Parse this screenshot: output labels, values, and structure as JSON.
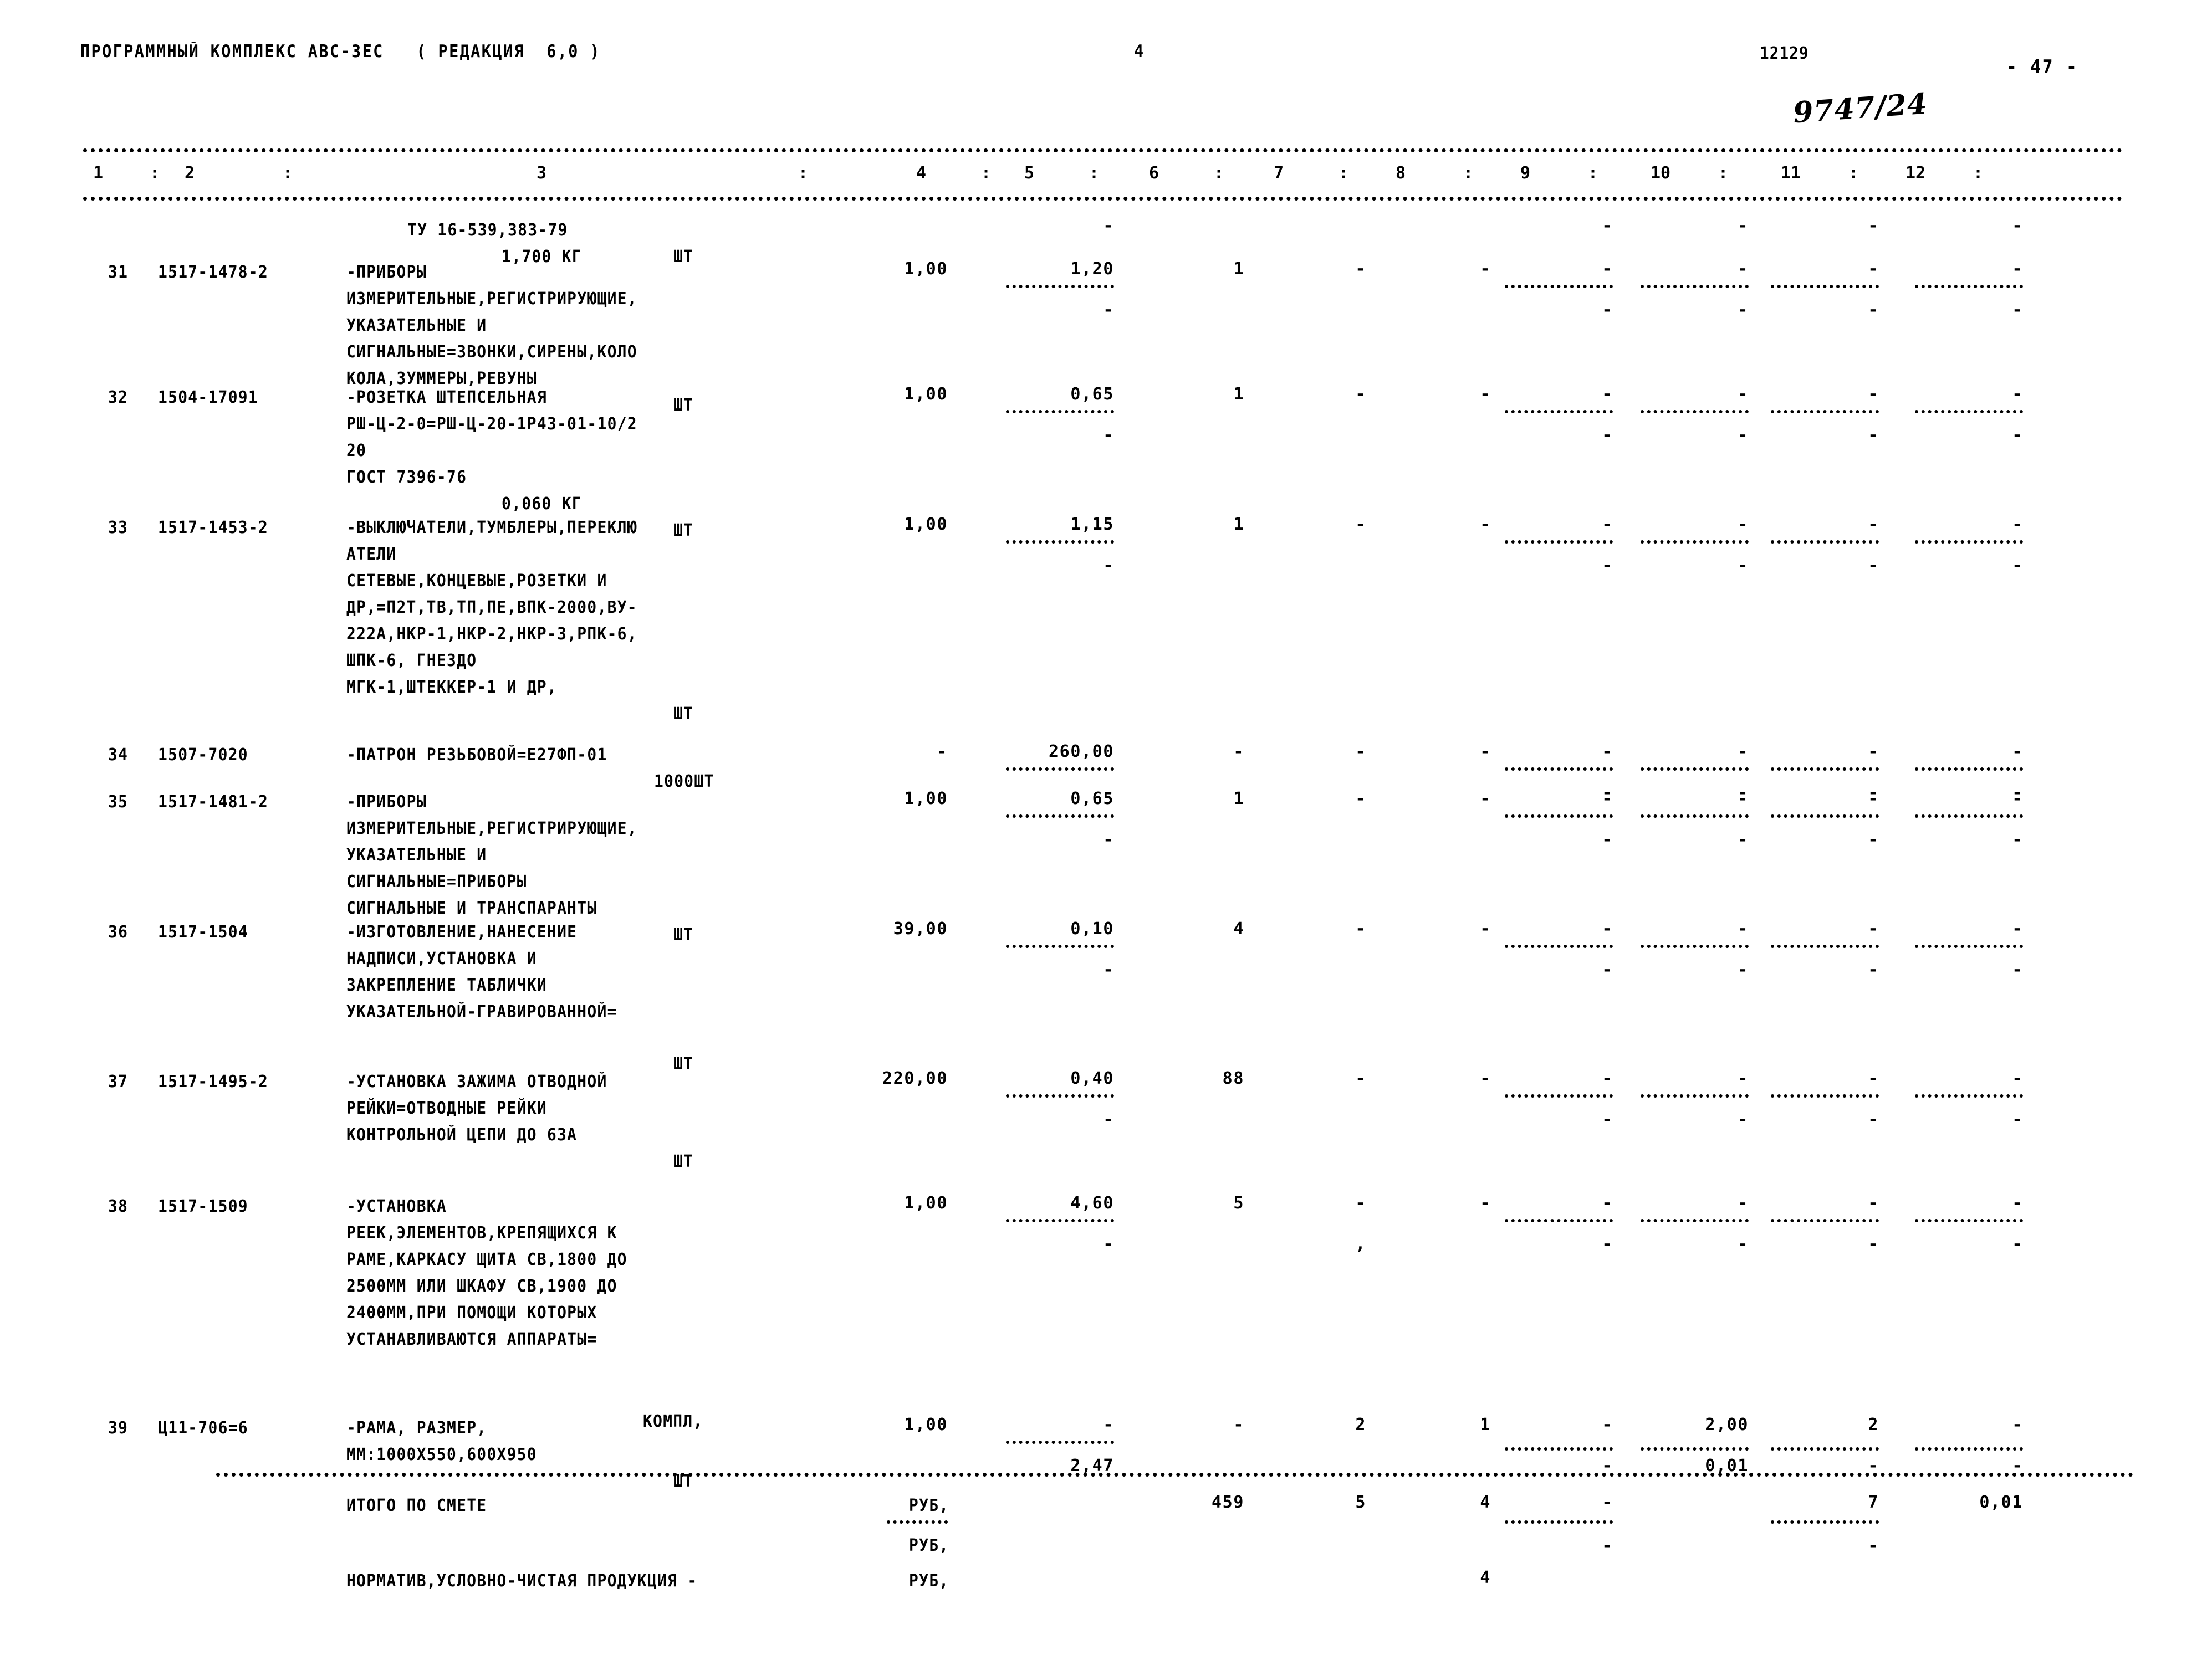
{
  "header": {
    "program_title": "ПРОГРАММНЫЙ КОМПЛЕКС АВС-ЗЕС   ( РЕДАКЦИЯ  6,0 )",
    "page_no": "4",
    "doc_code": "12129",
    "sheet_no": "- 47 -",
    "handwritten_note": "9747/24"
  },
  "column_headers": [
    "1",
    "2",
    "3",
    "4",
    "5",
    "6",
    "7",
    "8",
    "9",
    "10",
    "11",
    "12"
  ],
  "column_separator": ":",
  "rows": [
    {
      "no": "",
      "code": "",
      "desc_lines": [
        "ТУ 16-539,383-79",
        "1,700 КГ"
      ],
      "unit": "ШТ",
      "c4": "",
      "c5": "-",
      "c6": "",
      "c7": "",
      "c8": "",
      "c9": "-",
      "c10": "-",
      "c11": "-",
      "c12": "-"
    },
    {
      "no": "31",
      "code": "1517-1478-2",
      "desc_lines": [
        "-ПРИБОРЫ",
        "ИЗМЕРИТЕЛЬНЫЕ,РЕГИСТРИРУЮЩИЕ,",
        "УКАЗАТЕЛЬНЫЕ И",
        "СИГНАЛЬНЫЕ=ЗВОНКИ,СИРЕНЫ,КОЛО",
        "КОЛА,ЗУММЕРЫ,РЕВУНЫ"
      ],
      "unit": "ШТ",
      "c4": "1,00",
      "c5": "1,20",
      "c6": "1",
      "c7": "-",
      "c8": "-",
      "c9": "-",
      "c10": "-",
      "c11": "-",
      "c12": "-",
      "sub5": "-",
      "sub9": "-",
      "sub10": "-",
      "sub11": "-",
      "sub12": "-"
    },
    {
      "no": "32",
      "code": "1504-17091",
      "desc_lines": [
        "-РОЗЕТКА ШТЕПСЕЛЬНАЯ",
        "РШ-Ц-2-0=РШ-Ц-20-1Р43-01-10/2",
        "20",
        "ГОСТ 7396-76",
        "0,060 КГ"
      ],
      "unit": "ШТ",
      "c4": "1,00",
      "c5": "0,65",
      "c6": "1",
      "c7": "-",
      "c8": "-",
      "c9": "-",
      "c10": "-",
      "c11": "-",
      "c12": "-",
      "sub5": "-",
      "sub9": "-",
      "sub10": "-",
      "sub11": "-",
      "sub12": "-"
    },
    {
      "no": "33",
      "code": "1517-1453-2",
      "desc_lines": [
        "-ВЫКЛЮЧАТЕЛИ,ТУМБЛЕРЫ,ПЕРЕКЛЮ",
        "АТЕЛИ",
        "СЕТЕВЫЕ,КОНЦЕВЫЕ,РОЗЕТКИ И",
        "ДР,=П2Т,ТВ,ТП,ПЕ,ВПК-2000,ВУ-",
        "222А,НКР-1,НКР-2,НКР-3,РПК-6,",
        "ШПК-6, ГНЕЗДО",
        "МГК-1,ШТЕККЕР-1 И ДР,"
      ],
      "unit": "ШТ",
      "c4": "1,00",
      "c5": "1,15",
      "c6": "1",
      "c7": "-",
      "c8": "-",
      "c9": "-",
      "c10": "-",
      "c11": "-",
      "c12": "-",
      "sub5": "-",
      "sub9": "-",
      "sub10": "-",
      "sub11": "-",
      "sub12": "-"
    },
    {
      "no": "34",
      "code": "1507-7020",
      "desc_lines": [
        "-ПАТРОН РЕЗЬБОВОЙ=Е27ФП-01",
        "1000ШТ"
      ],
      "unit": "",
      "c4": "-",
      "c5": "260,00",
      "c6": "-",
      "c7": "-",
      "c8": "-",
      "c9": "-",
      "c10": "-",
      "c11": "-",
      "c12": "-",
      "sub5": "-",
      "sub9": "-",
      "sub10": "-",
      "sub11": "-",
      "sub12": "-"
    },
    {
      "no": "35",
      "code": "1517-1481-2",
      "desc_lines": [
        "-ПРИБОРЫ",
        "ИЗМЕРИТЕЛЬНЫЕ,РЕГИСТРИРУЮЩИЕ,",
        "УКАЗАТЕЛЬНЫЕ И",
        "СИГНАЛЬНЫЕ=ПРИБОРЫ",
        "СИГНАЛЬНЫЕ И ТРАНСПАРАНТЫ"
      ],
      "unit": "ШТ",
      "c4": "1,00",
      "c5": "0,65",
      "c6": "1",
      "c7": "-",
      "c8": "-",
      "c9": "-",
      "c10": "-",
      "c11": "-",
      "c12": "-",
      "sub5": "-",
      "sub9": "-",
      "sub10": "-",
      "sub11": "-",
      "sub12": "-"
    },
    {
      "no": "36",
      "code": "1517-1504",
      "desc_lines": [
        "-ИЗГОТОВЛЕНИЕ,НАНЕСЕНИЕ",
        "НАДПИСИ,УСТАНОВКА И",
        "ЗАКРЕПЛЕНИЕ ТАБЛИЧКИ",
        "УКАЗАТЕЛЬНОЙ-ГРАВИРОВАННОЙ="
      ],
      "unit": "ШТ",
      "c4": "39,00",
      "c5": "0,10",
      "c6": "4",
      "c7": "-",
      "c8": "-",
      "c9": "-",
      "c10": "-",
      "c11": "-",
      "c12": "-",
      "sub5": "-",
      "sub9": "-",
      "sub10": "-",
      "sub11": "-",
      "sub12": "-"
    },
    {
      "no": "37",
      "code": "1517-1495-2",
      "desc_lines": [
        "-УСТАНОВКА ЗАЖИМА ОТВОДНОЙ",
        "РЕЙКИ=ОТВОДНЫЕ РЕЙКИ",
        "КОНТРОЛЬНОЙ ЦЕПИ ДО 63А"
      ],
      "unit": "ШТ",
      "c4": "220,00",
      "c5": "0,40",
      "c6": "88",
      "c7": "-",
      "c8": "-",
      "c9": "-",
      "c10": "-",
      "c11": "-",
      "c12": "-",
      "sub5": "-",
      "sub9": "-",
      "sub10": "-",
      "sub11": "-",
      "sub12": "-"
    },
    {
      "no": "38",
      "code": "1517-1509",
      "desc_lines": [
        "-УСТАНОВКА",
        "РЕЕК,ЭЛЕМЕНТОВ,КРЕПЯЩИХСЯ К",
        "РАМЕ,КАРКАСУ ЩИТА СВ,1800 ДО",
        "2500ММ ИЛИ ШКАФУ СВ,1900 ДО",
        "2400ММ,ПРИ ПОМОЩИ КОТОРЫХ",
        "УСТАНАВЛИВАЮТСЯ АППАРАТЫ="
      ],
      "unit": "КОМПЛ,",
      "c4": "1,00",
      "c5": "4,60",
      "c6": "5",
      "c7": "-",
      "c8": "-",
      "c9": "-",
      "c10": "-",
      "c11": "-",
      "c12": "-",
      "sub5": "-",
      "sub7": ",",
      "sub9": "-",
      "sub10": "-",
      "sub11": "-",
      "sub12": "-"
    },
    {
      "no": "39",
      "code": "Ц11-706=6",
      "desc_lines": [
        "-РАМА, РАЗМЕР,",
        "ММ:1000Х550,600Х950"
      ],
      "unit": "ШТ",
      "c4": "1,00",
      "c5": "-",
      "c6": "-",
      "c7": "2",
      "c8": "1",
      "c9": "-",
      "c10": "2,00",
      "c11": "2",
      "c12": "-",
      "sub5": "2,47",
      "sub9": "-",
      "sub10": "0,01",
      "sub11": "-",
      "sub12": "-"
    }
  ],
  "totals": {
    "label": "ИТОГО ПО СМЕТЕ",
    "unit": "РУБ,",
    "c6": "459",
    "c7": "5",
    "c8": "4",
    "c9": "-",
    "c10": "",
    "c11": "7",
    "c12": "0,01",
    "sub_unit": "РУБ,",
    "sub9": "-",
    "sub11": "-"
  },
  "normative": {
    "label": "НОРМАТИВ,УСЛОВНО-ЧИСТАЯ ПРОДУКЦИЯ -",
    "unit": "РУБ,",
    "c8": "4"
  }
}
